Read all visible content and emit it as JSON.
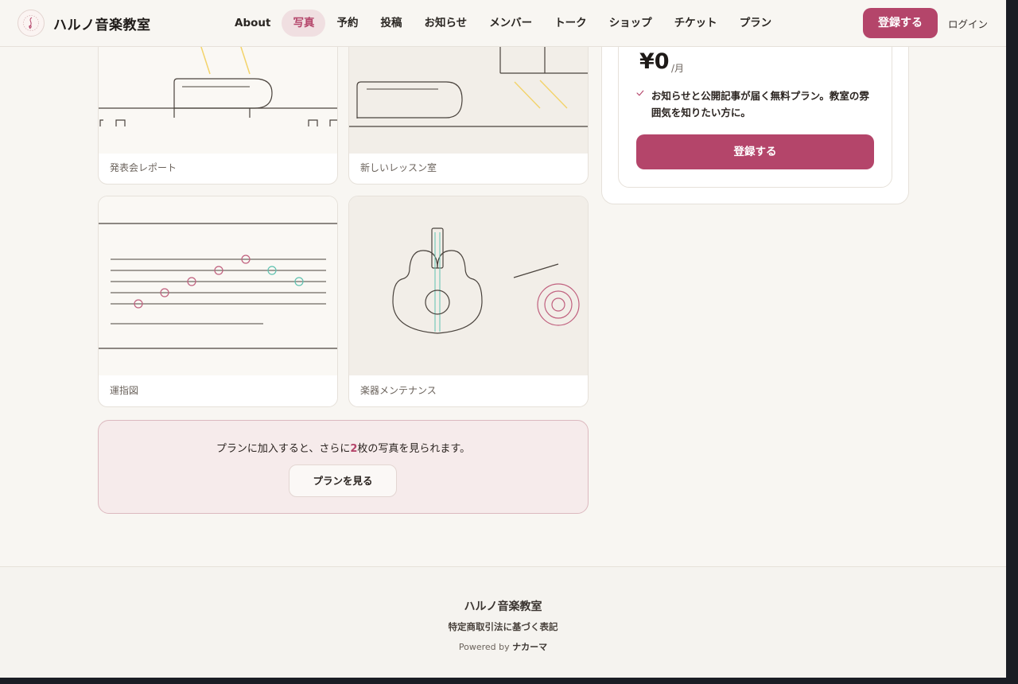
{
  "header": {
    "brand": "ハルノ音楽教室",
    "nav": [
      {
        "label": "About",
        "active": false
      },
      {
        "label": "写真",
        "active": true
      },
      {
        "label": "予約",
        "active": false
      },
      {
        "label": "投稿",
        "active": false
      },
      {
        "label": "お知らせ",
        "active": false
      },
      {
        "label": "メンバー",
        "active": false
      },
      {
        "label": "トーク",
        "active": false
      },
      {
        "label": "ショップ",
        "active": false
      },
      {
        "label": "チケット",
        "active": false
      },
      {
        "label": "プラン",
        "active": false
      }
    ],
    "register_label": "登録する",
    "login_label": "ログイン"
  },
  "photos": [
    {
      "caption": "発表会レポート"
    },
    {
      "caption": "新しいレッスン室"
    },
    {
      "caption": "運指図"
    },
    {
      "caption": "楽器メンテナンス"
    }
  ],
  "upsell": {
    "text_before": "プランに加入すると、さらに",
    "count": "2",
    "text_after": "枚の写真を見られます。",
    "button_label": "プランを見る"
  },
  "plan": {
    "price": "¥0",
    "price_unit": "/月",
    "feature": "お知らせと公開記事が届く無料プラン。教室の雰囲気を知りたい方に。",
    "button_label": "登録する"
  },
  "footer": {
    "name": "ハルノ音楽教室",
    "law_link": "特定商取引法に基づく表記",
    "powered_prefix": "Powered by",
    "powered_brand": "ナカーマ"
  },
  "colors": {
    "accent": "#b4456a",
    "background": "#f8f6f2",
    "teal": "#5fc2b0",
    "yellow": "#f3d36a"
  },
  "icons": [
    "music-note-logo-icon",
    "check-icon"
  ]
}
